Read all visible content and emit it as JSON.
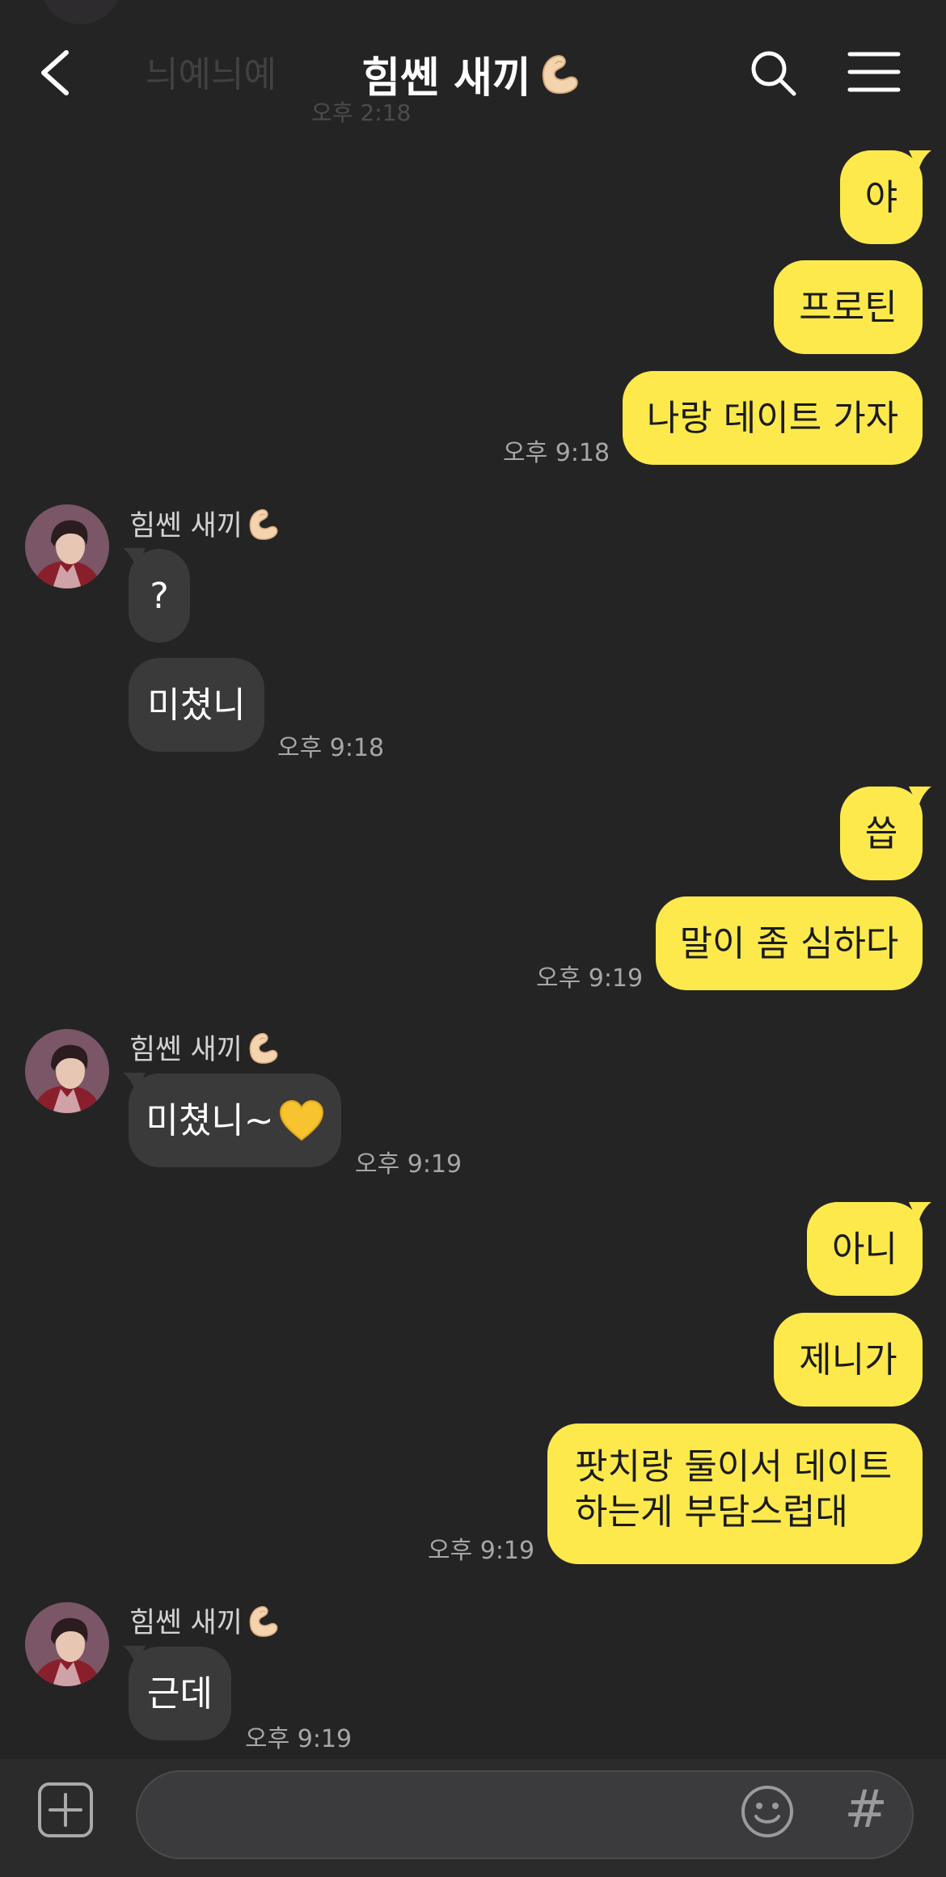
{
  "header": {
    "title": "힘쎈 새끼",
    "title_icon": "flexed-biceps-emoji",
    "back_icon": "chevron-left-icon",
    "search_icon": "search-icon",
    "menu_icon": "menu-icon",
    "faded_prev_message": "늬예늬예",
    "faded_prev_time": "오후 2:18"
  },
  "messages": [
    {
      "from": "me",
      "text": "야"
    },
    {
      "from": "me",
      "text": "프로틴"
    },
    {
      "from": "me",
      "text": "나랑 데이트 가자",
      "time": "오후 9:18"
    },
    {
      "from": "them",
      "sender": "힘쎈 새끼",
      "text": "?"
    },
    {
      "from": "them",
      "text": "미쳤니",
      "time": "오후 9:18"
    },
    {
      "from": "me",
      "text": "씁"
    },
    {
      "from": "me",
      "text": "말이 좀 심하다",
      "time": "오후 9:19"
    },
    {
      "from": "them",
      "sender": "힘쎈 새끼",
      "text": "미쳤니~",
      "emoji": "yellow-heart-emoji",
      "time": "오후 9:19"
    },
    {
      "from": "me",
      "text": "아니"
    },
    {
      "from": "me",
      "text": "제니가"
    },
    {
      "from": "me",
      "lines": [
        "팟치랑 둘이서 데이트",
        "하는게 부담스럽대"
      ],
      "time": "오후 9:19"
    },
    {
      "from": "them",
      "sender": "힘쎈 새끼",
      "text": "근데",
      "time": "오후 9:19"
    }
  ],
  "input_bar": {
    "value": "",
    "placeholder": "",
    "plus_icon": "plus-square-icon",
    "emoji_icon": "smiley-icon",
    "hash_label": "#"
  },
  "colors": {
    "background": "#242425",
    "my_bubble": "#fde94c",
    "their_bubble": "#3a3a3b",
    "timestamp": "#a7a7a9"
  }
}
